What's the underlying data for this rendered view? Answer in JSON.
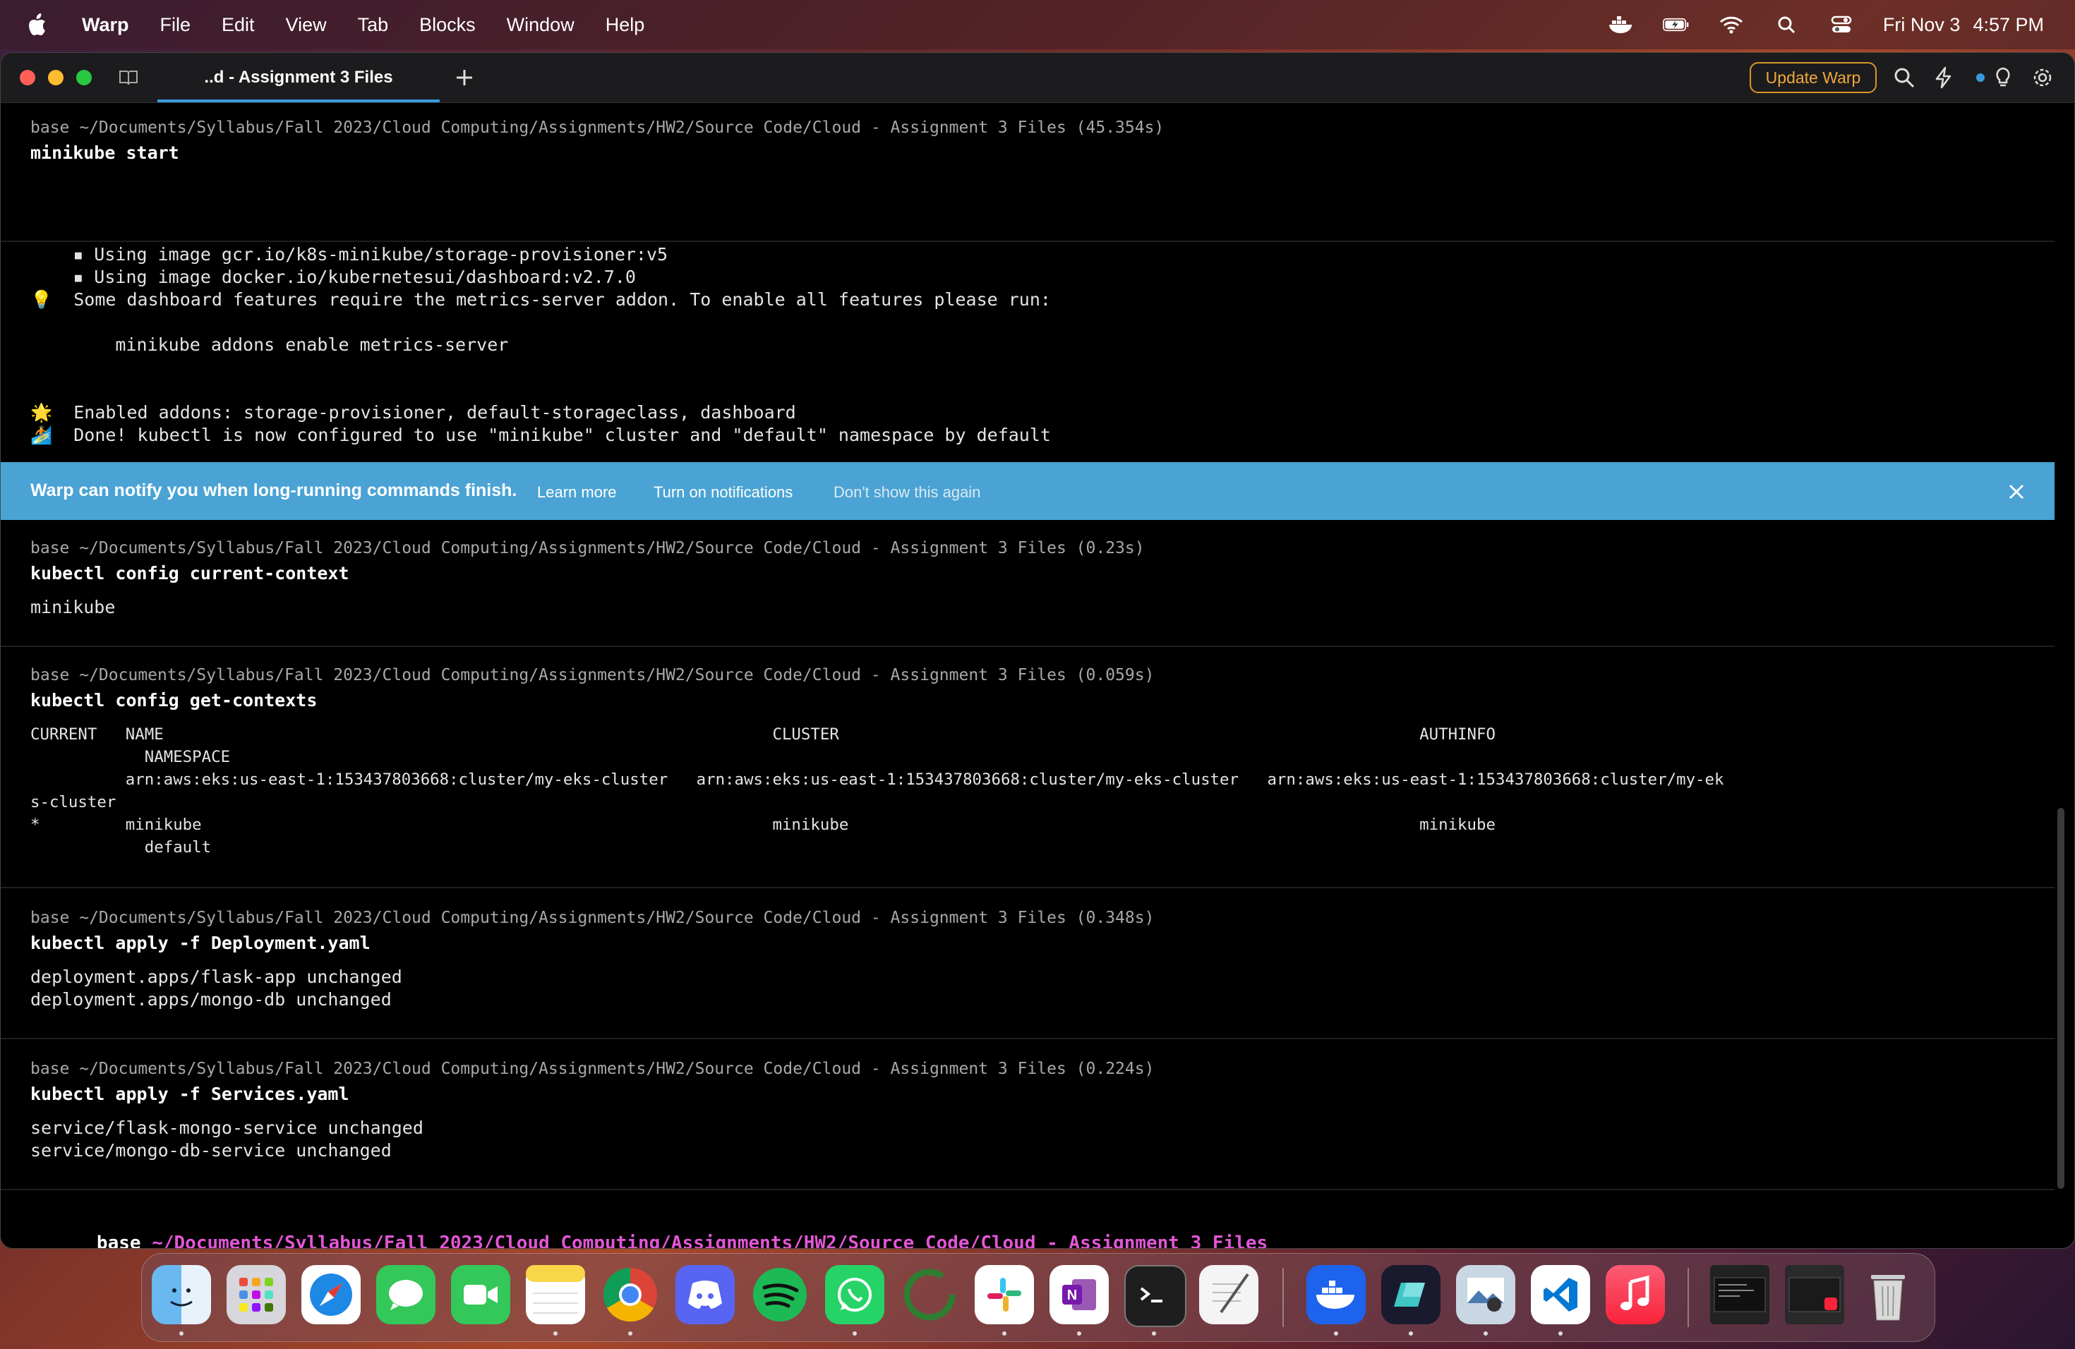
{
  "menubar": {
    "app": "Warp",
    "items": [
      "File",
      "Edit",
      "View",
      "Tab",
      "Blocks",
      "Window",
      "Help"
    ],
    "date": "Fri Nov 3",
    "time": "4:57 PM"
  },
  "window": {
    "tab_title": "..d - Assignment 3 Files",
    "update_label": "Update Warp"
  },
  "blocks": [
    {
      "header": "base ~/Documents/Syllabus/Fall 2023/Cloud Computing/Assignments/HW2/Source Code/Cloud - Assignment 3 Files (45.354s)",
      "command": "minikube start",
      "output": [
        "    ▪ Using image gcr.io/k8s-minikube/storage-provisioner:v5",
        "    ▪ Using image docker.io/kubernetesui/dashboard:v2.7.0",
        "💡  Some dashboard features require the metrics-server addon. To enable all features please run:",
        "",
        "        minikube addons enable metrics-server",
        "",
        "",
        "🌟  Enabled addons: storage-provisioner, default-storageclass, dashboard",
        "🏄  Done! kubectl is now configured to use \"minikube\" cluster and \"default\" namespace by default"
      ]
    },
    {
      "header": "base ~/Documents/Syllabus/Fall 2023/Cloud Computing/Assignments/HW2/Source Code/Cloud - Assignment 3 Files (0.23s)",
      "command": "kubectl config current-context",
      "output": [
        "minikube"
      ]
    },
    {
      "header": "base ~/Documents/Syllabus/Fall 2023/Cloud Computing/Assignments/HW2/Source Code/Cloud - Assignment 3 Files (0.059s)",
      "command": "kubectl config get-contexts",
      "output": [
        "CURRENT   NAME                                                                CLUSTER                                                             AUTHINFO",
        "            NAMESPACE",
        "          arn:aws:eks:us-east-1:153437803668:cluster/my-eks-cluster   arn:aws:eks:us-east-1:153437803668:cluster/my-eks-cluster   arn:aws:eks:us-east-1:153437803668:cluster/my-ek",
        "s-cluster",
        "*         minikube                                                            minikube                                                            minikube",
        "            default"
      ]
    },
    {
      "header": "base ~/Documents/Syllabus/Fall 2023/Cloud Computing/Assignments/HW2/Source Code/Cloud - Assignment 3 Files (0.348s)",
      "command": "kubectl apply -f Deployment.yaml",
      "output": [
        "deployment.apps/flask-app unchanged",
        "deployment.apps/mongo-db unchanged"
      ]
    },
    {
      "header": "base ~/Documents/Syllabus/Fall 2023/Cloud Computing/Assignments/HW2/Source Code/Cloud - Assignment 3 Files (0.224s)",
      "command": "kubectl apply -f Services.yaml",
      "output": [
        "service/flask-mongo-service unchanged",
        "service/mongo-db-service unchanged"
      ]
    }
  ],
  "notify": {
    "message": "Warp can notify you when long-running commands finish.",
    "learn_more": "Learn more",
    "turn_on": "Turn on notifications",
    "dismiss": "Don't show this again"
  },
  "prompt": {
    "env": "base",
    "path": "~/Documents/Syllabus/Fall 2023/Cloud Computing/Assignments/HW2/Source Code/Cloud - Assignment 3 Files"
  },
  "dock": {
    "apps": [
      "finder-icon",
      "launchpad-icon",
      "safari-icon",
      "messages-icon",
      "facetime-icon",
      "notes-icon",
      "chrome-icon",
      "discord-icon",
      "spotify-icon",
      "whatsapp-icon",
      "activity-icon",
      "slack-icon",
      "onenote-icon",
      "terminal-icon",
      "textedit-icon",
      "docker-icon",
      "warp-icon",
      "preview-icon",
      "vscode-icon",
      "music-icon"
    ]
  }
}
